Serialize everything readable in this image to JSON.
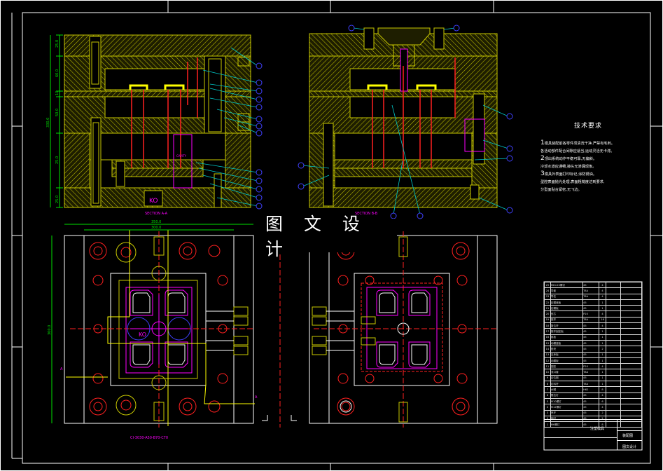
{
  "drawing": {
    "section_a_label": "SECTION A-A",
    "section_b_label": "SECTION B-B",
    "mold_code": "CI-3030-A50-B70-C70",
    "watermark": "图 文 设 计",
    "dims": {
      "total_height": "330.0",
      "plate_1": "25.0",
      "plate_2": "60.0",
      "plate_3": "10",
      "plate_4": "50.0",
      "plate_5": "25.0",
      "plate_6": "25.0",
      "width_outer": "350.0",
      "width_inner": "300.0",
      "plan_height": "300.0"
    },
    "cavity_text": "KO",
    "section_letter": "A"
  },
  "notes": {
    "title": "技术要求",
    "lines": [
      {
        "num": "1",
        "text": "模具装配前各零件须清洗干净,严禁有毛刺。"
      },
      {
        "num": "",
        "text": "各活动部件配合间隙应适当,运动灵活无卡滞。"
      },
      {
        "num": "2",
        "text": "顶出系统动作平稳可靠,无偏斜。"
      },
      {
        "num": "",
        "text": "冷却水道应通畅,接头无渗漏现象。"
      },
      {
        "num": "3",
        "text": "模具外表面打印标记,涂防锈油。"
      },
      {
        "num": "",
        "text": "型腔表面抛光处理,表面粗糙度达到要求,"
      },
      {
        "num": "",
        "text": "分型面贴合紧密,无飞边。"
      }
    ]
  },
  "bom_rows": [
    [
      "25",
      "M8×20螺钉",
      "45",
      "4",
      "",
      ""
    ],
    [
      "24",
      "导套",
      "T8A",
      "4",
      "",
      ""
    ],
    [
      "23",
      "导柱",
      "T8A",
      "4",
      "",
      ""
    ],
    [
      "22",
      "定模座板",
      "45",
      "1",
      "",
      ""
    ],
    [
      "21",
      "定模板",
      "45",
      "1",
      "",
      ""
    ],
    [
      "20",
      "型芯",
      "P20",
      "4",
      "",
      ""
    ],
    [
      "19",
      "推杆",
      "T8A",
      "16",
      "",
      ""
    ],
    [
      "18",
      "复位杆",
      "45",
      "4",
      "",
      ""
    ],
    [
      "17",
      "推杆固定板",
      "45",
      "1",
      "",
      ""
    ],
    [
      "16",
      "推板",
      "45",
      "1",
      "",
      ""
    ],
    [
      "15",
      "动模座板",
      "45",
      "1",
      "",
      ""
    ],
    [
      "14",
      "垫块",
      "45",
      "2",
      "",
      ""
    ],
    [
      "13",
      "支承板",
      "45",
      "1",
      "",
      ""
    ],
    [
      "12",
      "动模板",
      "45",
      "1",
      "",
      ""
    ],
    [
      "11",
      "型腔",
      "P20",
      "4",
      "",
      ""
    ],
    [
      "10",
      "浇口套",
      "T8A",
      "1",
      "",
      ""
    ],
    [
      "9",
      "定位圈",
      "45",
      "1",
      "",
      ""
    ],
    [
      "8",
      "拉料杆",
      "T8A",
      "1",
      "",
      ""
    ],
    [
      "7",
      "水嘴",
      "H62",
      "8",
      "",
      ""
    ],
    [
      "6",
      "限位钉",
      "45",
      "4",
      "",
      ""
    ],
    [
      "5",
      "M10螺钉",
      "45",
      "6",
      "",
      ""
    ],
    [
      "4",
      "M12螺钉",
      "45",
      "4",
      "",
      ""
    ],
    [
      "3",
      "吊环",
      "45",
      "2",
      "",
      ""
    ],
    [
      "2",
      "销钉",
      "45",
      "2",
      "",
      ""
    ],
    [
      "1",
      "M6螺钉",
      "45",
      "8",
      "",
      ""
    ]
  ],
  "title_block": {
    "name": "注塑模具",
    "drawing_no": "装配图",
    "school": "图文设计"
  },
  "colors": {
    "background": "#000000",
    "frame": "#ffffff",
    "hatch": "#c8c800",
    "plate_fill": "#2a2a00",
    "ejector": "#ff2020",
    "cavity": "#ff00ff",
    "leader": "#00c8c8",
    "balloon": "#4040ff",
    "dimension": "#00e000",
    "insert": "#ffff00"
  }
}
